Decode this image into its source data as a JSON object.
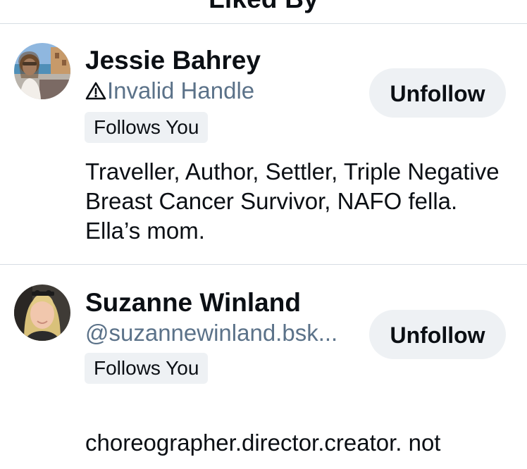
{
  "header": {
    "title": "Liked By",
    "back_icon": "chevron-left-icon"
  },
  "users": [
    {
      "name": "Jessie Bahrey",
      "handle_warning_icon": "warning-triangle-icon",
      "handle": "Invalid Handle",
      "badge": "Follows You",
      "button_label": "Unfollow",
      "bio": "Traveller, Author, Settler, Triple Negative Breast Cancer Survivor, NAFO fella. Ella’s mom."
    },
    {
      "name": "Suzanne Winland",
      "handle": "@suzannewinland.bsk...",
      "badge": "Follows You",
      "button_label": "Unfollow",
      "bio": "choreographer.director.creator. not"
    }
  ],
  "colors": {
    "handle": "#5b7289",
    "button_bg": "#eef1f4",
    "divider": "#d6dde3"
  }
}
